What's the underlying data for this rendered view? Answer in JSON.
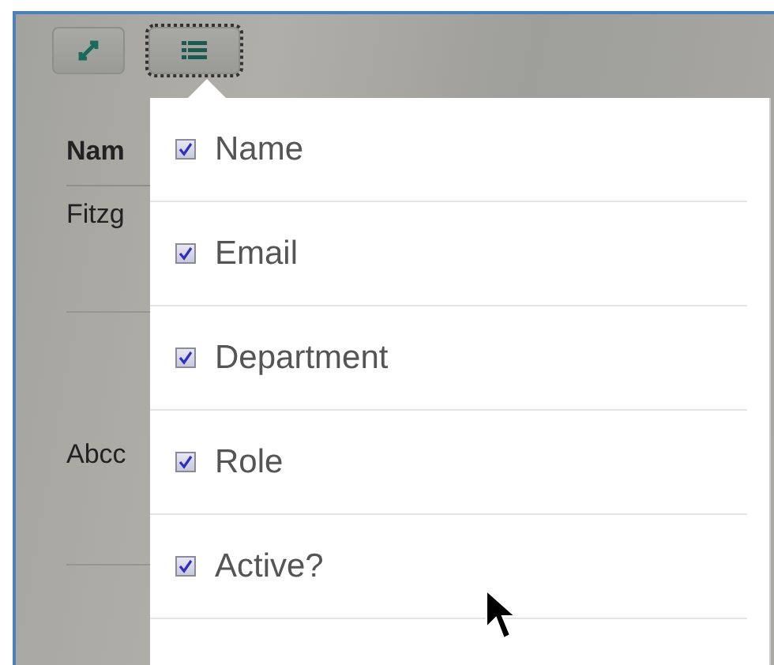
{
  "toolbar": {
    "buttons": [
      {
        "kind": "expand",
        "focused": false
      },
      {
        "kind": "columns",
        "focused": true
      }
    ]
  },
  "table": {
    "header": "Nam",
    "rows": [
      "Fitzg",
      "Abcc"
    ]
  },
  "column_menu": {
    "items": [
      {
        "label": "Name",
        "checked": true
      },
      {
        "label": "Email",
        "checked": true
      },
      {
        "label": "Department",
        "checked": true
      },
      {
        "label": "Role",
        "checked": true
      },
      {
        "label": "Active?",
        "checked": true
      }
    ]
  }
}
